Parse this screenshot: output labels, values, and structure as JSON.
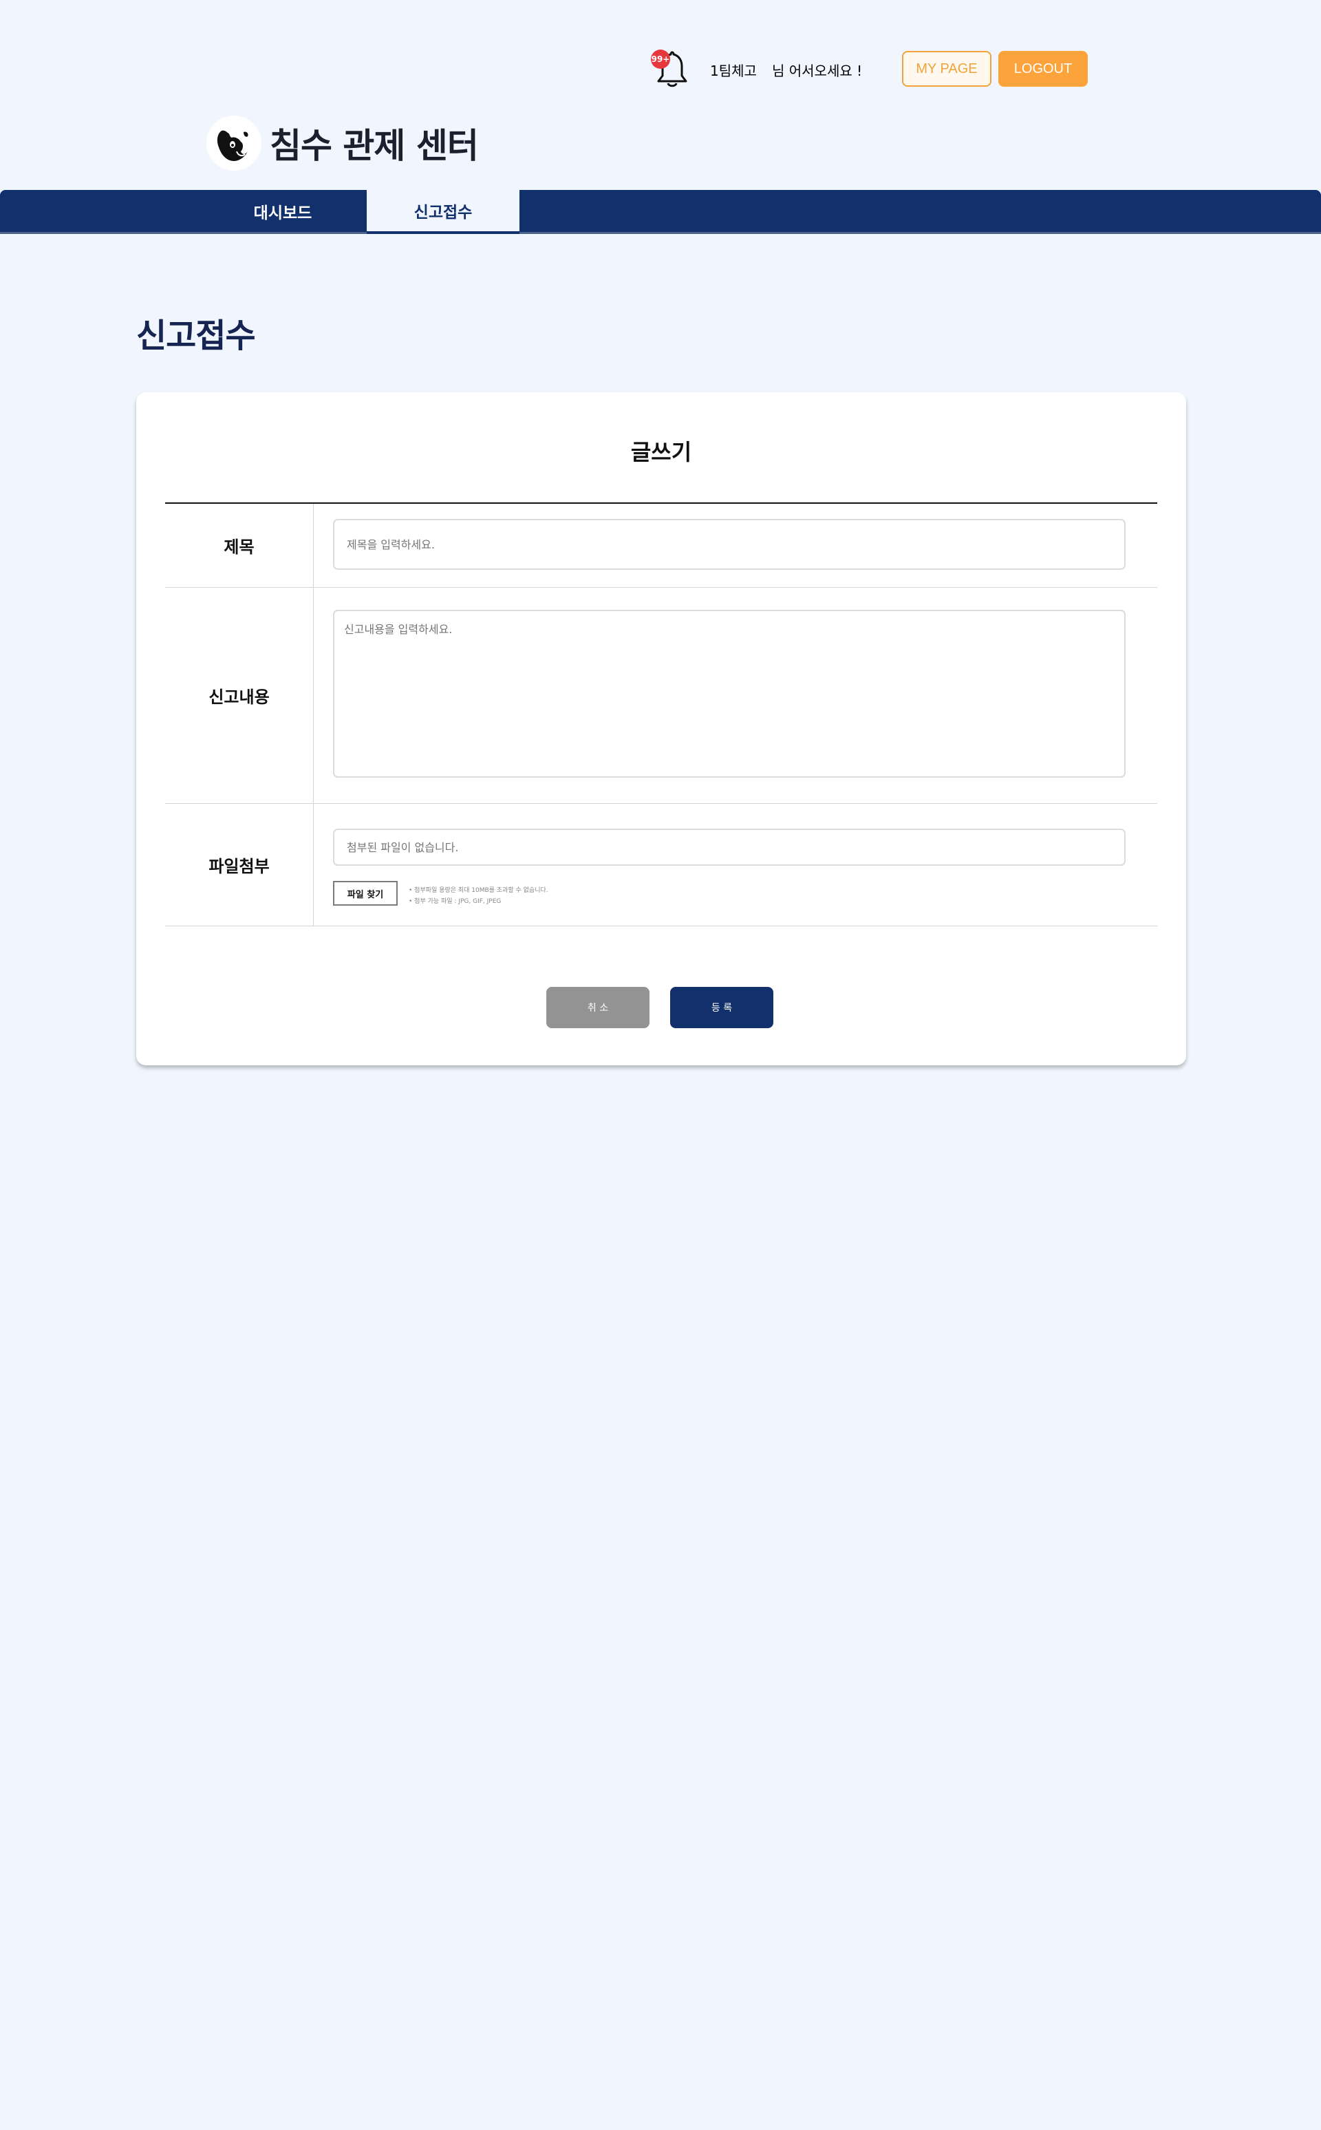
{
  "header": {
    "notification_count": "99+",
    "user_name": "1팀체고",
    "greeting": "님 어서오세요 !",
    "mypage_label": "MY PAGE",
    "logout_label": "LOGOUT",
    "brand_title": "침수 관제 센터",
    "logo_icon": "panda-logo-icon",
    "accent_color": "#fda33b",
    "primary_color": "#11306c"
  },
  "nav": {
    "tabs": [
      {
        "label": "대시보드",
        "active": false
      },
      {
        "label": "신고접수",
        "active": true
      }
    ]
  },
  "page": {
    "title": "신고접수"
  },
  "form": {
    "heading": "글쓰기",
    "title_label": "제목",
    "title_placeholder": "제목을 입력하세요.",
    "content_label": "신고내용",
    "content_placeholder": "신고내용을 입력하세요.",
    "file_label": "파일첨부",
    "file_placeholder": "첨부된 파일이 없습니다.",
    "file_button": "파일 찾기",
    "file_notes": [
      "• 첨부파일 용량은 최대 10MB를 초과할 수 없습니다.",
      "• 첨부 가능 파일 : JPG, GIF, JPEG"
    ],
    "cancel_label": "취 소",
    "submit_label": "등 록"
  }
}
